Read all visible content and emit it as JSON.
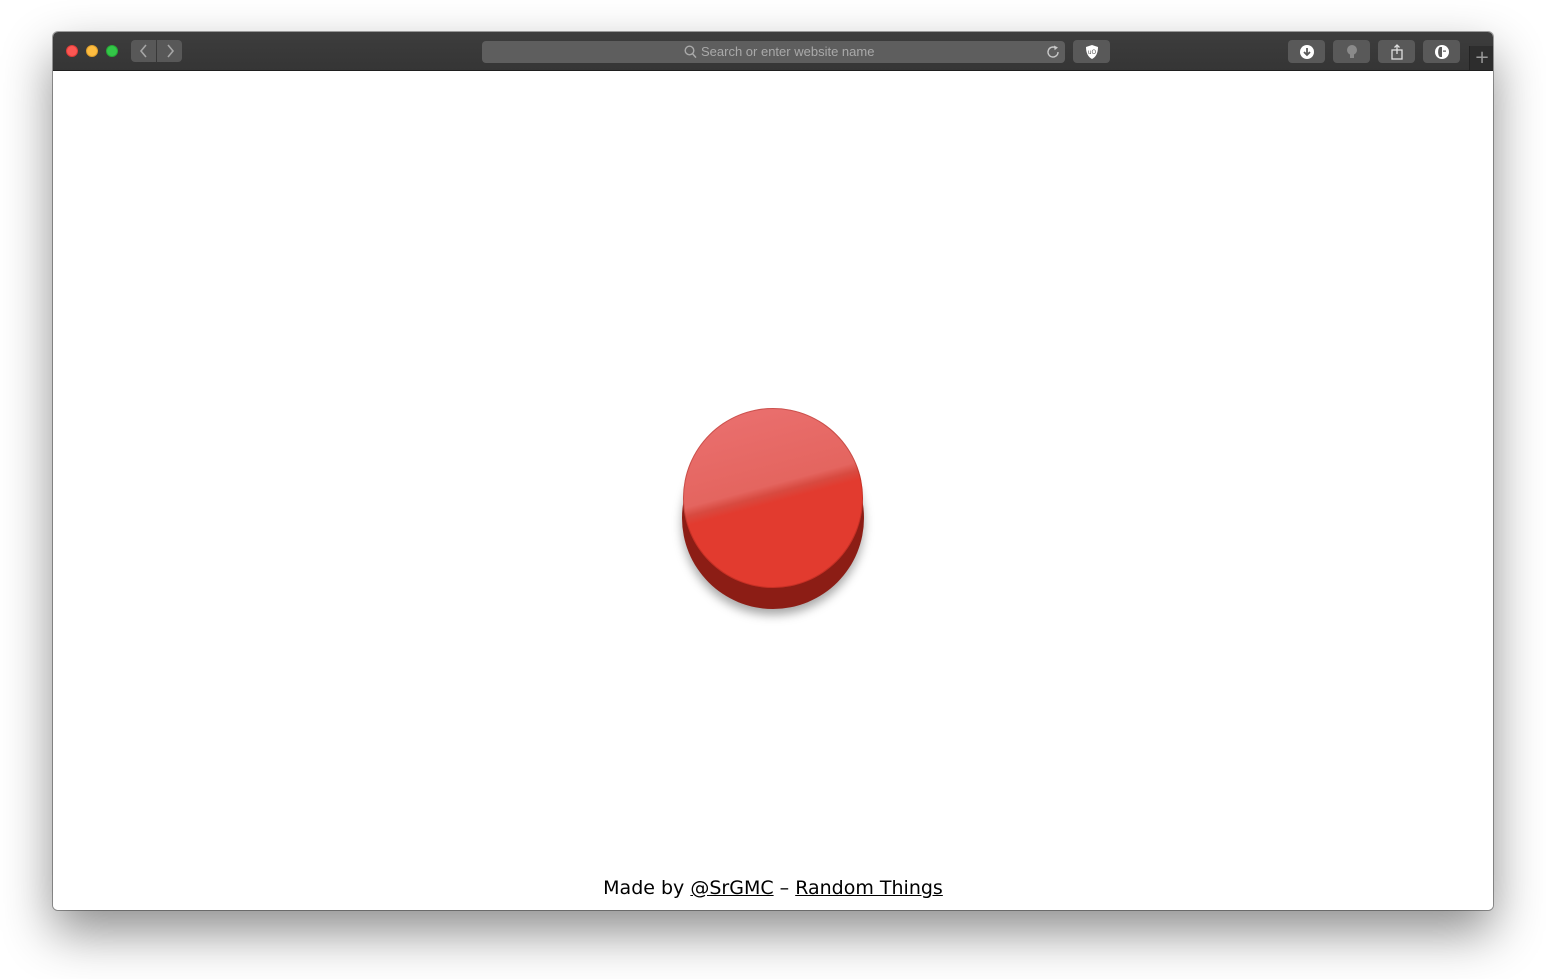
{
  "browser": {
    "address_bar": {
      "placeholder": "Search or enter website name"
    },
    "new_tab_label": "+",
    "icons": {
      "back": "chevron-left-icon",
      "forward": "chevron-right-icon",
      "search": "search-icon",
      "reload": "reload-icon",
      "ublock": "ublock-shield-icon",
      "download": "download-icon",
      "idea": "lightbulb-icon",
      "share": "share-icon",
      "duckduckgo": "duckduckgo-icon"
    },
    "traffic_lights": {
      "close": "#fc5753",
      "minimize": "#fdbc40",
      "maximize": "#33c748"
    }
  },
  "page": {
    "button_color": "#e23b2f",
    "footer": {
      "prefix": "Made by",
      "author_link": "@SrGMC",
      "separator": "–",
      "project_link": "Random Things"
    }
  }
}
